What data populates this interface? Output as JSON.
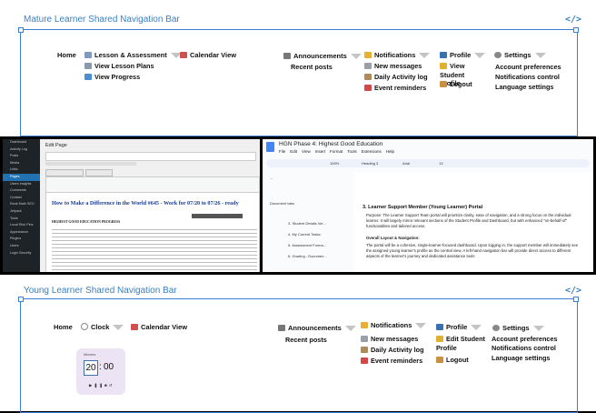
{
  "mature": {
    "title": "Mature Learner Shared Navigation Bar",
    "code_icon": "</>",
    "home": "Home",
    "lesson": "Lesson & Assessment",
    "view_lesson_plans": "View Lesson Plans",
    "view_progress": "View Progress",
    "calendar": "Calendar View",
    "announcements": "Announcements",
    "recent_posts": "Recent posts",
    "notifications": "Notifications",
    "new_messages": "New messages",
    "daily_log": "Daily Activity log",
    "event_reminders": "Event reminders",
    "profile": "Profile",
    "view_student_profile": "View Student Profile",
    "logout": "Logout",
    "settings": "Settings",
    "account_prefs": "Account preferences",
    "notif_control": "Notifications control",
    "language": "Language settings"
  },
  "young": {
    "title": "Young Learner Shared Navigation Bar",
    "code_icon": "</>",
    "home": "Home",
    "clock": "Clock",
    "calendar": "Calendar View",
    "timer_label": "Minutes",
    "timer_min": "20",
    "timer_sep": ":",
    "timer_sec": "00",
    "announcements": "Announcements",
    "recent_posts": "Recent posts",
    "notifications": "Notifications",
    "new_messages": "New messages",
    "daily_log": "Daily Activity log",
    "event_reminders": "Event reminders",
    "profile": "Profile",
    "edit_student_profile": "Edit Student Profile",
    "logout": "Logout",
    "settings": "Settings",
    "account_prefs": "Account preferences",
    "notif_control": "Notifications control",
    "language": "Language settings"
  },
  "wp": {
    "edit_page": "Edit Page",
    "post_title": "How to Make a Difference in the World #645 - Work for 07/20 to 07/26 - ready",
    "section_heading": "HIGHEST GOOD EDUCATION PROGRESS",
    "sidebar": [
      "Dashboard",
      "Activity Log",
      "Posts",
      "Media",
      "Links",
      "Pages",
      "Users Insights",
      "Comments",
      "Contact",
      "Rank Math SEO",
      "Jetpack",
      "Tools",
      "Local Rich Pins",
      "Appearance",
      "Plugins",
      "Users",
      "Login Security"
    ]
  },
  "gdoc": {
    "title": "HGN Phase 4: Highest Good Education",
    "menu": [
      "File",
      "Edit",
      "View",
      "Insert",
      "Format",
      "Tools",
      "Extensions",
      "Help"
    ],
    "zoom": "100%",
    "style": "Heading 3",
    "font": "Arial",
    "font_size": "13",
    "doc_tabs_label": "Document tabs",
    "outline": [
      "3. Student Details Vie...",
      "4. My Current Tasks:",
      "5. Assessment Forma...",
      "6. Grading - Documen..."
    ],
    "heading": "3. Learner Support Member (Young Learner) Portal",
    "purpose": "Purpose: The Learner Support Team portal will prioritize clarity, ease of navigation, and a strong focus on the individual learner. It will largely mirror relevant sections of the Student Profile and Dashboard, but with enhanced \"on-behalf-of\" functionalities and tailored access.",
    "overall_label": "Overall Layout & Navigation:",
    "overall_text": "The portal will be a cohesive, single-learner-focused dashboard. Upon logging in, the support member will immediately see the assigned young learner's profile as the central view. A left-hand navigation bar will provide direct access to different aspects of the learner's journey and dedicated assistance tools"
  }
}
